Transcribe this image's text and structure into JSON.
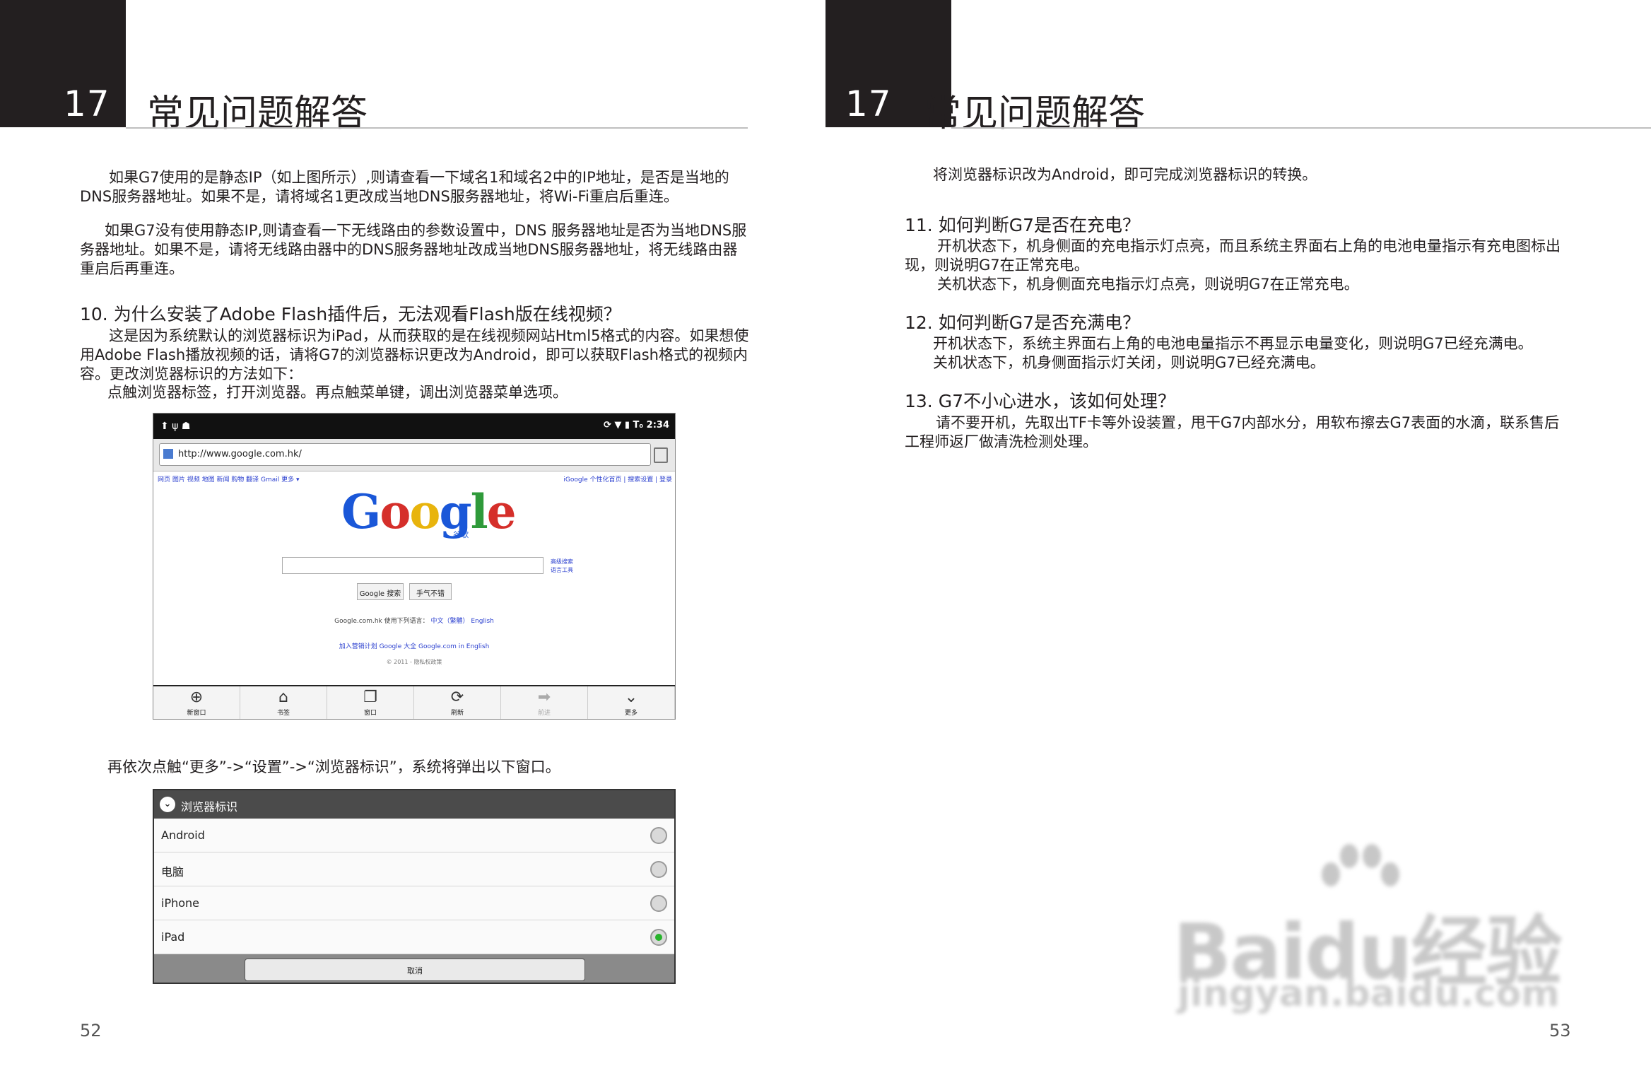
{
  "left_page": {
    "chapter_number": "17",
    "chapter_title": "常见问题解答",
    "page_number": "52",
    "intro_p1_line1": "如果G7使用的是静态IP（如上图所示）,则请查看一下域名1和域名2中的IP地址，是否是当地的",
    "intro_p1_line2": "DNS服务器地址。如果不是，请将域名1更改成当地DNS服务器地址，将Wi-Fi重启后重连。",
    "intro_p2_line1": "如果G7没有使用静态IP,则请查看一下无线路由的参数设置中，DNS 服务器地址是否为当地DNS服",
    "intro_p2_line2": "务器地址。如果不是，请将无线路由器中的DNS服务器地址改成当地DNS服务器地址，将无线路由器",
    "intro_p2_line3": "重启后再重连。",
    "q10_title": "10.  为什么安装了Adobe Flash插件后，无法观看Flash版在线视频？",
    "q10_line1": "这是因为系统默认的浏览器标识为iPad，从而获取的是在线视频网站Html5格式的内容。如果想使",
    "q10_line2": "用Adobe Flash播放视频的话，请将G7的浏览器标识更改为Android，即可以获取Flash格式的视频内",
    "q10_line3": "容。更改浏览器标识的方法如下：",
    "q10_line4": "点触浏览器标签，打开浏览器。再点触菜单键，调出浏览器菜单选项。",
    "q10_after": "再依次点触“更多”->“设置”->“浏览器标识”，系统将弹出以下窗口。"
  },
  "browser_shot": {
    "status_time": "2:34",
    "url": "http://www.google.com.hk/",
    "links_left": "网页  图片  视频  地图  新闻  购物  翻译  Gmail  更多 ▾",
    "links_right": "iGoogle 个性化首页 | 搜索设置 | 登录",
    "logo_sub": "谷歌",
    "adv_search": "高级搜索",
    "lang_tools": "语言工具",
    "btn_search": "Google 搜索",
    "btn_lucky": "手气不错",
    "lang_line": "Google.com.hk 使用下列语言：",
    "lang_options": "中文（繁體）  English",
    "footer_links": "加入营销计划    Google 大全    Google.com in English",
    "copyright": "© 2011 - 隐私权政策",
    "menu": [
      {
        "icon": "⊕",
        "label": "新窗口"
      },
      {
        "icon": "⌂",
        "label": "书签"
      },
      {
        "icon": "❐",
        "label": "窗口"
      },
      {
        "icon": "⟳",
        "label": "刷新"
      },
      {
        "icon": "➡",
        "label": "前进"
      },
      {
        "icon": "⌄",
        "label": "更多"
      }
    ]
  },
  "ua_dialog": {
    "title": "浏览器标识",
    "options": [
      "Android",
      "电脑",
      "iPhone",
      "iPad"
    ],
    "selected": "iPad",
    "cancel": "取消"
  },
  "right_page": {
    "chapter_number": "17",
    "chapter_title": "常见问题解答",
    "page_number": "53",
    "top_line": "将浏览器标识改为Android，即可完成浏览器标识的转换。",
    "q11_title": "11.  如何判断G7是否在充电？",
    "q11_line1": "开机状态下，机身侧面的充电指示灯点亮，而且系统主界面右上角的电池电量指示有充电图标出",
    "q11_line2": "现，则说明G7在正常充电。",
    "q11_line3": "关机状态下，机身侧面充电指示灯点亮，则说明G7在正常充电。",
    "q12_title": "12.  如何判断G7是否充满电？",
    "q12_line1": "开机状态下，系统主界面右上角的电池电量指示不再显示电量变化，则说明G7已经充满电。",
    "q12_line2": "关机状态下，机身侧面指示灯关闭，则说明G7已经充满电。",
    "q13_title": "13.  G7不小心进水，该如何处理？",
    "q13_line1": "请不要开机，先取出TF卡等外设装置，甩干G7内部水分，用软布擦去G7表面的水滴，联系售后",
    "q13_line2": "工程师返厂做清洗检测处理。"
  },
  "watermark": {
    "brand": "Baidu经验",
    "url": "jingyan.baidu.com"
  }
}
